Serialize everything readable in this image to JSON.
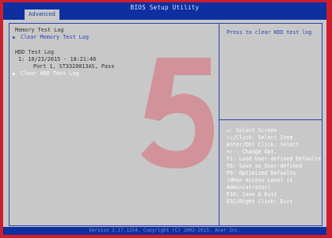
{
  "window": {
    "title": "BIOS Setup Utility"
  },
  "tabs": [
    {
      "label": "Advanced"
    }
  ],
  "left_panel": {
    "memory_log_label": "Memory Test Log",
    "clear_memory_label": "Clear Memory Test Log",
    "hdd_log_label": "HDD Test Log",
    "hdd_entry_date": "1: 10/23/2015 - 18:21:40",
    "hdd_entry_port": "Port 1, ST3320813AS, Pass",
    "clear_hdd_label": "Clear HDD Test Log"
  },
  "help": {
    "description": "Press to clear HDD test log",
    "keys": [
      "↔: Select Screen",
      "↑↓/Click: Select Item",
      "Enter/Dbl Click: Select",
      "+/-: Change Opt.",
      "F1: Load User-defined Defaults",
      "F6: Save as User-defined",
      "F9: Optimized Defaults",
      "(When Access Level is",
      "Administrator)",
      "F10: Save & Exit",
      "ESC/Right Click: Exit"
    ]
  },
  "watermark": {
    "digit": "5"
  },
  "footer": {
    "text": "Version 2.17.1254. Copyright (C) 2002-2015, Acer Inc."
  },
  "colors": {
    "title_bar": "#0d2fa0",
    "panel_bg": "#c8c8c8",
    "link_text": "#2f44b8",
    "border_red": "#cc1f2e",
    "watermark": "#d6808b"
  }
}
